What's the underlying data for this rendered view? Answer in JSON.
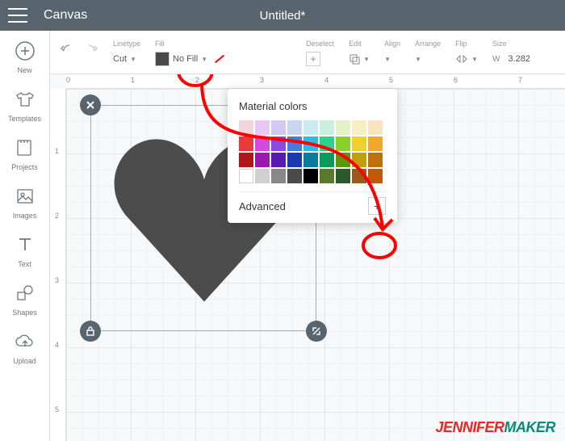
{
  "app": {
    "title": "Canvas",
    "document": "Untitled*"
  },
  "sidebar": {
    "items": [
      {
        "label": "New"
      },
      {
        "label": "Templates"
      },
      {
        "label": "Projects"
      },
      {
        "label": "Images"
      },
      {
        "label": "Text"
      },
      {
        "label": "Shapes"
      },
      {
        "label": "Upload"
      }
    ]
  },
  "toolbar": {
    "linetype_label": "Linetype",
    "linetype_value": "Cut",
    "fill_label": "Fill",
    "fill_value": "No Fill",
    "deselect_label": "Deselect",
    "edit_label": "Edit",
    "align_label": "Align",
    "arrange_label": "Arrange",
    "flip_label": "Flip",
    "size_label": "Size",
    "size_w": "W",
    "size_value": "3.282"
  },
  "ruler": {
    "h": [
      "0",
      "1",
      "2",
      "3",
      "4",
      "5",
      "6",
      "7"
    ],
    "v": [
      "1",
      "2",
      "3",
      "4",
      "5"
    ]
  },
  "popup": {
    "title": "Material colors",
    "advanced": "Advanced",
    "swatches": [
      "#f2d6db",
      "#e8c8f0",
      "#d2c8f0",
      "#c8d6f0",
      "#c8ecf0",
      "#c8f0dc",
      "#e6f0c8",
      "#f6f0c0",
      "#f6e4c0",
      "#e83a3a",
      "#d24ae0",
      "#8a4ae0",
      "#4a7ae0",
      "#2fb8e0",
      "#2fd08a",
      "#8ad02f",
      "#f0d02f",
      "#f0a82f",
      "#b01818",
      "#9a1ab0",
      "#5a1ab0",
      "#1a3ab0",
      "#0a7aa0",
      "#0a9a5a",
      "#5a9a0a",
      "#c0a008",
      "#c07008",
      "#ffffff",
      "#d0d0d0",
      "#888888",
      "#4a4a4a",
      "#000000",
      "#5a7a2a",
      "#2a5a2a",
      "#9a5a1a",
      "#c05a0a"
    ]
  },
  "watermark": {
    "a": "JENNIFER",
    "b": "MAKER"
  }
}
